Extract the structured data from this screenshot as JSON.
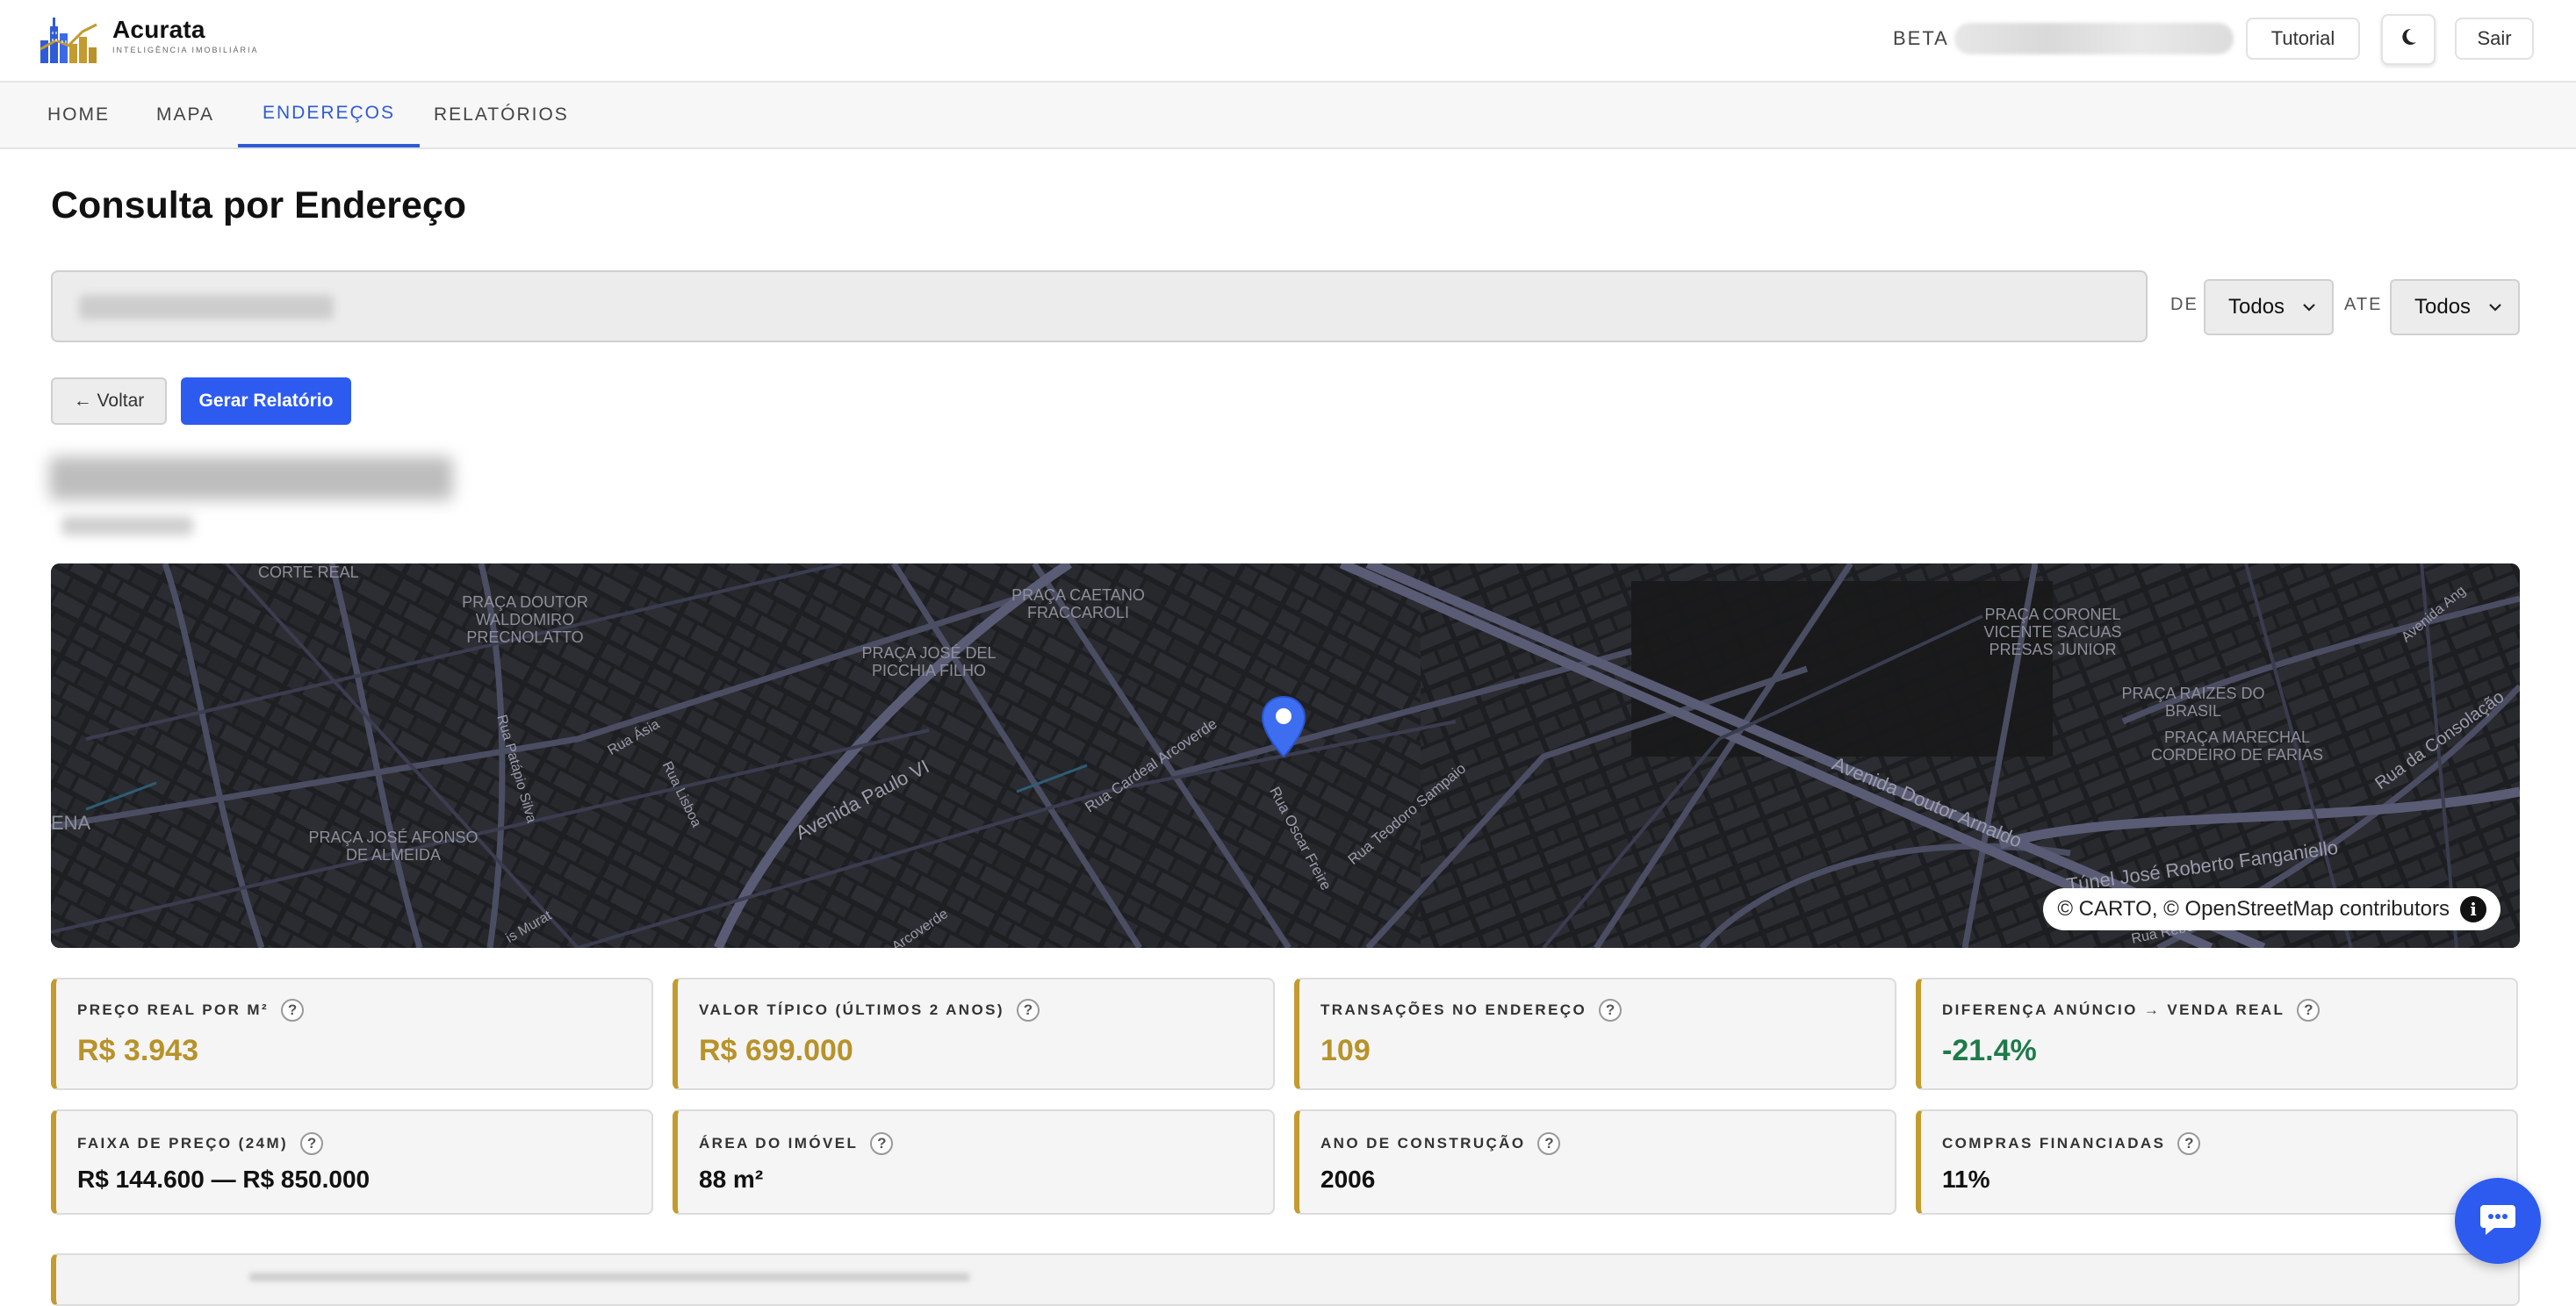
{
  "app": {
    "name": "Acurata",
    "tagline": "INTELIGÊNCIA IMOBILIÁRIA",
    "beta_label": "BETA",
    "tutorial_label": "Tutorial",
    "logout_label": "Sair",
    "theme_icon": "moon-icon"
  },
  "nav": {
    "tabs": [
      {
        "label": "HOME",
        "active": false
      },
      {
        "label": "MAPA",
        "active": false
      },
      {
        "label": "ENDEREÇOS",
        "active": true
      },
      {
        "label": "RELATÓRIOS",
        "active": false
      }
    ]
  },
  "page": {
    "title": "Consulta por Endereço",
    "from_label": "DE",
    "to_label": "ATE",
    "from_value": "Todos",
    "to_value": "Todos",
    "back_label": "← Voltar",
    "generate_label": "Gerar Relatório"
  },
  "map": {
    "attribution": "© CARTO, © OpenStreetMap contributors",
    "info_glyph": "i",
    "places": [
      "CORTE REAL",
      "PRAÇA DOUTOR WALDOMIRO PRECNOLATTO",
      "PRAÇA CAETANO FRACCAROLI",
      "PRAÇA JOSÉ DEL PICCHIA FILHO",
      "PRAÇA CORONEL VICENTE SACUAS PRESAS JUNIOR",
      "PRAÇA RAIZES DO BRASIL",
      "PRAÇA MARECHAL CORDEIRO DE FARIAS",
      "PRAÇA JOSÉ AFONSO DE ALMEIDA",
      "ENA"
    ],
    "streets": [
      "Avenida Paulo VI",
      "Rua Cardeal Arcoverde",
      "Rua Oscar Freire",
      "Rua Teodoro Sampaio",
      "Avenida Doutor Arnaldo",
      "Túnel José Roberto Fanganiello",
      "Rua da Consolação",
      "Rua Ásia",
      "Rua Lisboa",
      "Rua Patápio Silva",
      "Avenida Ang",
      "Arcoverde",
      "is Murat",
      "Rua Rebo"
    ]
  },
  "metrics": [
    {
      "label": "PREÇO REAL POR M²",
      "value": "R$ 3.943",
      "tone": "gold"
    },
    {
      "label": "VALOR TÍPICO (ÚLTIMOS 2 ANOS)",
      "value": "R$ 699.000",
      "tone": "gold"
    },
    {
      "label": "TRANSAÇÕES NO ENDEREÇO",
      "value": "109",
      "tone": "gold"
    },
    {
      "label": "DIFERENÇA ANÚNCIO → VENDA REAL",
      "value": "-21.4%",
      "tone": "green"
    },
    {
      "label": "FAIXA DE PREÇO (24M)",
      "value": "R$ 144.600 — R$ 850.000",
      "tone": "dark"
    },
    {
      "label": "ÁREA DO IMÓVEL",
      "value": "88 m²",
      "tone": "dark"
    },
    {
      "label": "ANO DE CONSTRUÇÃO",
      "value": "2006",
      "tone": "dark"
    },
    {
      "label": "COMPRAS FINANCIADAS",
      "value": "11%",
      "tone": "dark"
    }
  ],
  "help_glyph": "?",
  "colors": {
    "accent": "#2d5bf0",
    "gold": "#b8922a",
    "green": "#1f7a4a",
    "card_border": "#c39b2e"
  }
}
